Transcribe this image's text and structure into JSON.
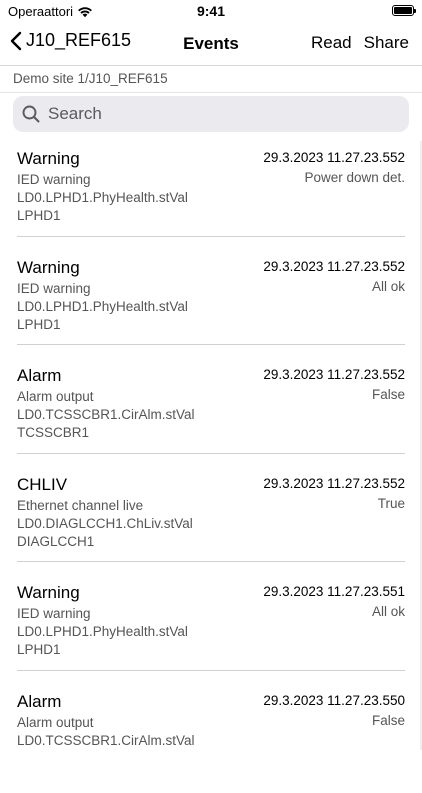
{
  "status": {
    "carrier": "Operaattori",
    "time": "9:41"
  },
  "nav": {
    "back_label": "J10_REF615",
    "title": "Events",
    "read_label": "Read",
    "share_label": "Share"
  },
  "path": "Demo site 1/J10_REF615",
  "search": {
    "placeholder": "Search",
    "value": ""
  },
  "events": [
    {
      "type": "Warning",
      "description": "IED warning",
      "reference": "LD0.LPHD1.PhyHealth.stVal",
      "node": "LPHD1",
      "timestamp": "29.3.2023 11.27.23.552",
      "value": "Power down det."
    },
    {
      "type": "Warning",
      "description": "IED warning",
      "reference": "LD0.LPHD1.PhyHealth.stVal",
      "node": "LPHD1",
      "timestamp": "29.3.2023 11.27.23.552",
      "value": "All ok"
    },
    {
      "type": "Alarm",
      "description": "Alarm output",
      "reference": "LD0.TCSSCBR1.CirAlm.stVal",
      "node": "TCSSCBR1",
      "timestamp": "29.3.2023 11.27.23.552",
      "value": "False"
    },
    {
      "type": "CHLIV",
      "description": "Ethernet channel live",
      "reference": "LD0.DIAGLCCH1.ChLiv.stVal",
      "node": "DIAGLCCH1",
      "timestamp": "29.3.2023 11.27.23.552",
      "value": "True"
    },
    {
      "type": "Warning",
      "description": "IED warning",
      "reference": "LD0.LPHD1.PhyHealth.stVal",
      "node": "LPHD1",
      "timestamp": "29.3.2023 11.27.23.551",
      "value": "All ok"
    },
    {
      "type": "Alarm",
      "description": "Alarm output",
      "reference": "LD0.TCSSCBR1.CirAlm.stVal",
      "node": "",
      "timestamp": "29.3.2023 11.27.23.550",
      "value": "False"
    }
  ]
}
